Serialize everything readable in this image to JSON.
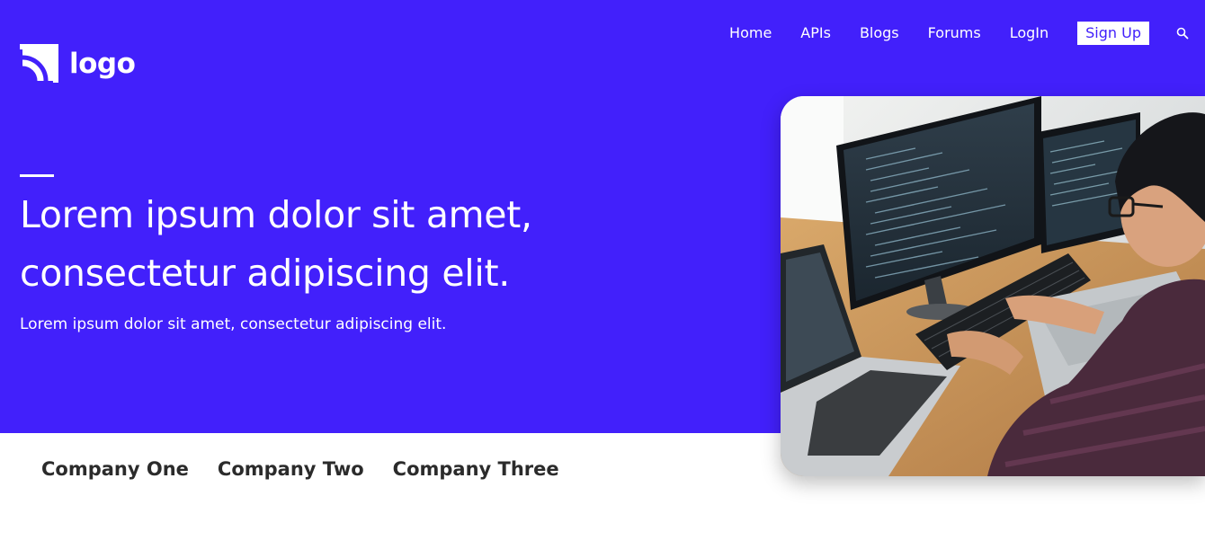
{
  "brand": {
    "logo_text": "logo"
  },
  "nav": {
    "items": [
      {
        "label": "Home"
      },
      {
        "label": "APIs"
      },
      {
        "label": "Blogs"
      },
      {
        "label": "Forums"
      },
      {
        "label": "LogIn"
      }
    ],
    "signup_label": "Sign Up",
    "search_icon": "search-icon"
  },
  "hero": {
    "headline": "Lorem ipsum dolor sit amet, consectetur adipiscing elit.",
    "subtext": "Lorem ipsum dolor sit amet, consectetur adipiscing elit.",
    "image_icon": "developer-at-computer-photo"
  },
  "companies": [
    {
      "name": "Company One"
    },
    {
      "name": "Company Two"
    },
    {
      "name": "Company Three"
    }
  ],
  "colors": {
    "brand_primary": "#4220fb",
    "text_on_brand": "#ffffff",
    "company_text": "#2b2b2b"
  }
}
